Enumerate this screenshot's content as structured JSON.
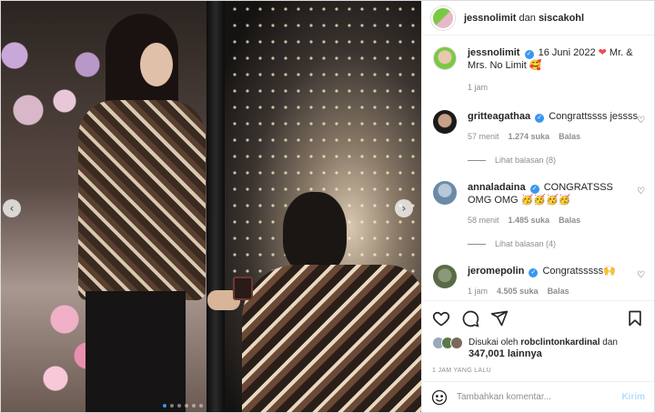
{
  "header": {
    "user1": "jessnolimit",
    "and": " dan ",
    "user2": "siscakohl"
  },
  "caption": {
    "user": "jessnolimit",
    "date": "16 Juni 2022",
    "text_after": " Mr. & Mrs. No Limit ",
    "emoji": "🥰",
    "time": "1 jam"
  },
  "comments": [
    {
      "user": "gritteagathaa",
      "text": "Congrattssss jessss",
      "time": "57 menit",
      "likes": "1.274 suka",
      "reply": "Balas",
      "replies": "Lihat balasan (8)"
    },
    {
      "user": "annaladaina",
      "text": "CONGRATSSS OMG OMG 🥳🥳🥳🥳",
      "time": "58 menit",
      "likes": "1.485 suka",
      "reply": "Balas",
      "replies": "Lihat balasan (4)"
    },
    {
      "user": "jeromepolin",
      "text": "Congratsssss🙌",
      "time": "1 jam",
      "likes": "4.505 suka",
      "reply": "Balas"
    }
  ],
  "likes": {
    "prefix": "Disukai oleh ",
    "liker": "robclintonkardinal",
    "mid": " dan",
    "count": "347,001 lainnya"
  },
  "timestamp": "1 JAM YANG LALU",
  "composer": {
    "placeholder": "Tambahkan komentar...",
    "post_label": "Kirim"
  },
  "carousel": {
    "prev": "‹",
    "next": "›"
  },
  "icons": {
    "heart": "heart-icon",
    "comment": "comment-icon",
    "share": "share-icon",
    "bookmark": "bookmark-icon",
    "emoji": "emoji-icon",
    "verified": "verified-icon"
  },
  "colors": {
    "accent": "#3897f0",
    "heart_red": "#ed4956",
    "muted": "#8e8e8e",
    "post_disabled": "#b2dffc"
  }
}
